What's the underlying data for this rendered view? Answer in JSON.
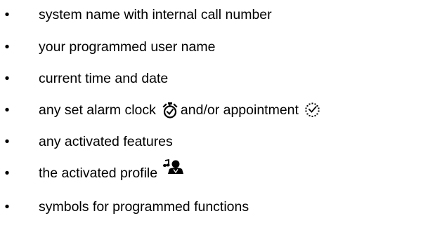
{
  "bullet_char": "•",
  "items": [
    {
      "text": "system name with internal call number"
    },
    {
      "text": "your programmed user name"
    },
    {
      "text": "current time and date"
    },
    {
      "text_before": "any set alarm clock",
      "icon1": "alarm-clock-icon",
      "text_middle": "and/or appointment",
      "icon2": "appointment-icon"
    },
    {
      "text": "any activated features"
    },
    {
      "text": "the activated profile",
      "icon": "profile-icon"
    },
    {
      "text": "symbols for programmed functions"
    }
  ]
}
